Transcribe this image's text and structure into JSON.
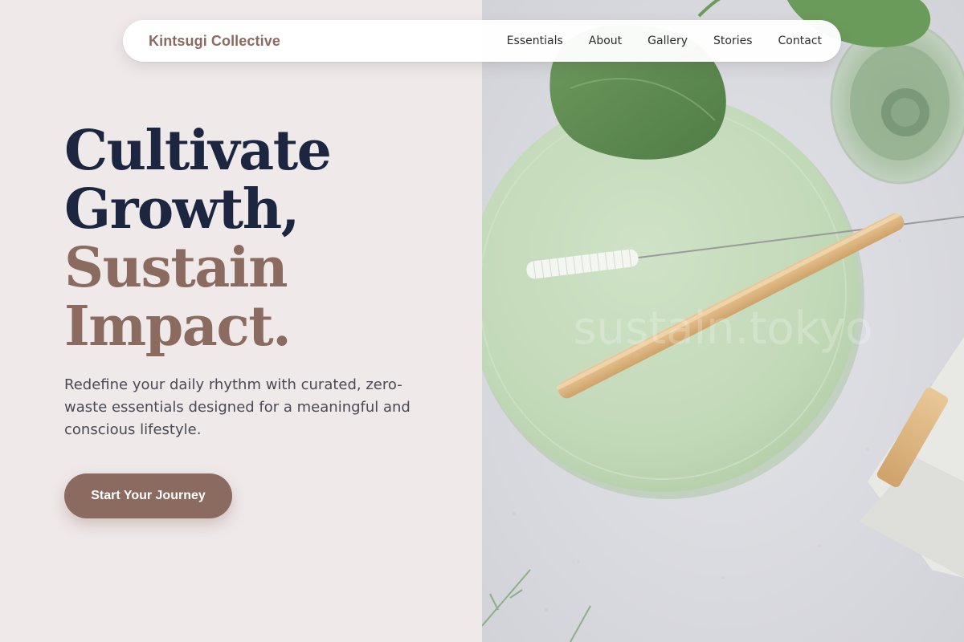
{
  "brand": {
    "name": "Kintsugi Collective"
  },
  "nav": {
    "items": [
      {
        "label": "Essentials"
      },
      {
        "label": "About"
      },
      {
        "label": "Gallery"
      },
      {
        "label": "Stories"
      },
      {
        "label": "Contact"
      }
    ]
  },
  "hero": {
    "headline": {
      "line1": "Cultivate",
      "line2": "Growth,",
      "line3": "Sustain",
      "line4": "Impact."
    },
    "subtext": "Redefine your daily rhythm with curated, zero-waste essentials designed for a meaningful and conscious lifestyle.",
    "cta_label": "Start Your Journey",
    "image_watermark": "sustain.tokyo"
  },
  "colors": {
    "page_background": "#efe9e9",
    "headline_dark": "#1c2640",
    "accent": "#8b6a5f",
    "body_text": "#4a4a55",
    "plate": "#c6dcbd",
    "counter": "#dcdde2"
  }
}
